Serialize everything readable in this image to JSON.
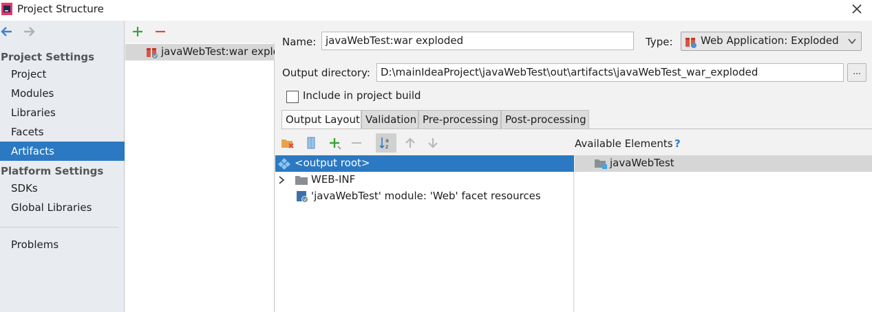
{
  "window": {
    "title": "Project Structure",
    "close_glyph": "✕",
    "app_icon": "intellij-icon"
  },
  "sidebar": {
    "back_icon": "arrow-left-icon",
    "forward_icon": "arrow-right-icon",
    "project_settings_title": "Project Settings",
    "project_settings_items": [
      {
        "label": "Project"
      },
      {
        "label": "Modules"
      },
      {
        "label": "Libraries"
      },
      {
        "label": "Facets"
      },
      {
        "label": "Artifacts",
        "selected": true
      }
    ],
    "platform_settings_title": "Platform Settings",
    "platform_settings_items": [
      {
        "label": "SDKs"
      },
      {
        "label": "Global Libraries"
      }
    ],
    "problems_label": "Problems"
  },
  "artifact_list": {
    "add_icon": "plus-icon",
    "remove_icon": "minus-icon",
    "items": [
      {
        "label": "javaWebTest:war exploded",
        "selected": true,
        "icon": "war-artifact-icon"
      }
    ]
  },
  "details": {
    "name_label": "Name:",
    "name_value": "javaWebTest:war exploded",
    "type_label": "Type:",
    "type_value": "Web Application: Exploded",
    "output_dir_label": "Output directory:",
    "output_dir_value": "D:\\mainIdeaProject\\javaWebTest\\out\\artifacts\\javaWebTest_war_exploded",
    "browse_label": "...",
    "include_in_build_label": "Include in project build",
    "include_in_build_checked": false
  },
  "tabs": [
    {
      "label": "Output Layout",
      "active": true
    },
    {
      "label": "Validation",
      "active": false
    },
    {
      "label": "Pre-processing",
      "active": false
    },
    {
      "label": "Post-processing",
      "active": false
    }
  ],
  "layout_toolbar": {
    "icons": [
      "create-directory-icon",
      "create-archive-icon",
      "add-copy-icon",
      "remove-icon",
      "sort-icon",
      "move-up-icon",
      "move-down-icon"
    ]
  },
  "output_tree": [
    {
      "label": "<output root>",
      "selected": true,
      "icon": "output-root-icon",
      "expandable": false
    },
    {
      "label": "WEB-INF",
      "selected": false,
      "icon": "folder-icon",
      "expandable": true
    },
    {
      "label": "'javaWebTest' module: 'Web' facet resources",
      "selected": false,
      "icon": "web-facet-icon",
      "expandable": false
    }
  ],
  "available_elements": {
    "title": "Available Elements",
    "help_glyph": "?",
    "items": [
      {
        "label": "javaWebTest",
        "icon": "module-folder-icon"
      }
    ]
  },
  "colors": {
    "selection_blue": "#2b79c2",
    "add_green": "#3aa33a",
    "remove_red": "#d84a3a"
  }
}
